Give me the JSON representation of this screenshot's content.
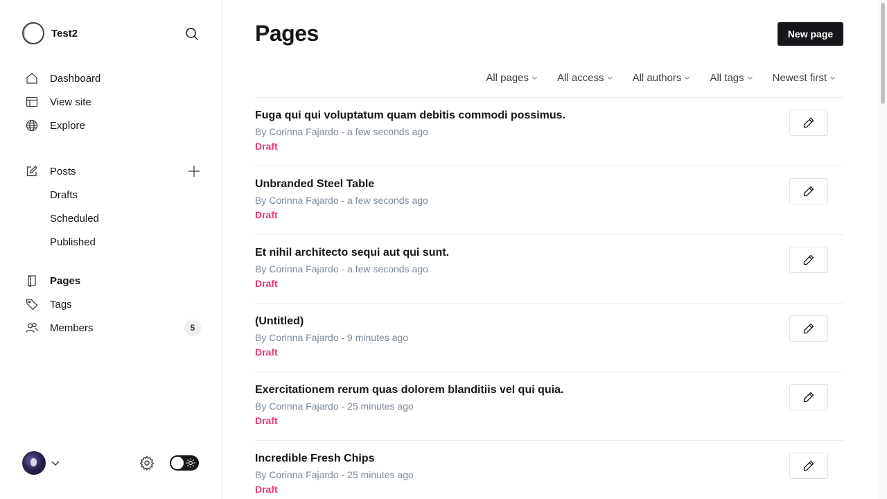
{
  "app": {
    "site_name": "Test2"
  },
  "sidebar": {
    "primary": [
      {
        "label": "Dashboard",
        "icon": "home-icon"
      },
      {
        "label": "View site",
        "icon": "browser-icon"
      },
      {
        "label": "Explore",
        "icon": "globe-icon"
      }
    ],
    "posts": {
      "label": "Posts",
      "icon": "edit-icon",
      "sub": [
        {
          "label": "Drafts"
        },
        {
          "label": "Scheduled"
        },
        {
          "label": "Published"
        }
      ]
    },
    "secondary": [
      {
        "label": "Pages",
        "icon": "page-icon",
        "active": true
      },
      {
        "label": "Tags",
        "icon": "tag-icon"
      },
      {
        "label": "Members",
        "icon": "members-icon",
        "count": "5"
      }
    ]
  },
  "main": {
    "title": "Pages",
    "new_button": "New page",
    "filters": [
      {
        "label": "All pages"
      },
      {
        "label": "All access"
      },
      {
        "label": "All authors"
      },
      {
        "label": "All tags"
      },
      {
        "label": "Newest first"
      }
    ],
    "rows": [
      {
        "title": "Fuga qui qui voluptatum quam debitis commodi possimus.",
        "meta": "By Corinna Fajardo - a few seconds ago",
        "status": "Draft"
      },
      {
        "title": "Unbranded Steel Table",
        "meta": "By Corinna Fajardo - a few seconds ago",
        "status": "Draft"
      },
      {
        "title": "Et nihil architecto sequi aut qui sunt.",
        "meta": "By Corinna Fajardo - a few seconds ago",
        "status": "Draft"
      },
      {
        "title": "(Untitled)",
        "meta": "By Corinna Fajardo - 9 minutes ago",
        "status": "Draft"
      },
      {
        "title": "Exercitationem rerum quas dolorem blanditiis vel qui quia.",
        "meta": "By Corinna Fajardo - 25 minutes ago",
        "status": "Draft"
      },
      {
        "title": "Incredible Fresh Chips",
        "meta": "By Corinna Fajardo - 25 minutes ago",
        "status": "Draft"
      }
    ]
  },
  "colors": {
    "accent": "#15171a",
    "draft": "#e8397a",
    "muted": "#7c8b9a"
  }
}
